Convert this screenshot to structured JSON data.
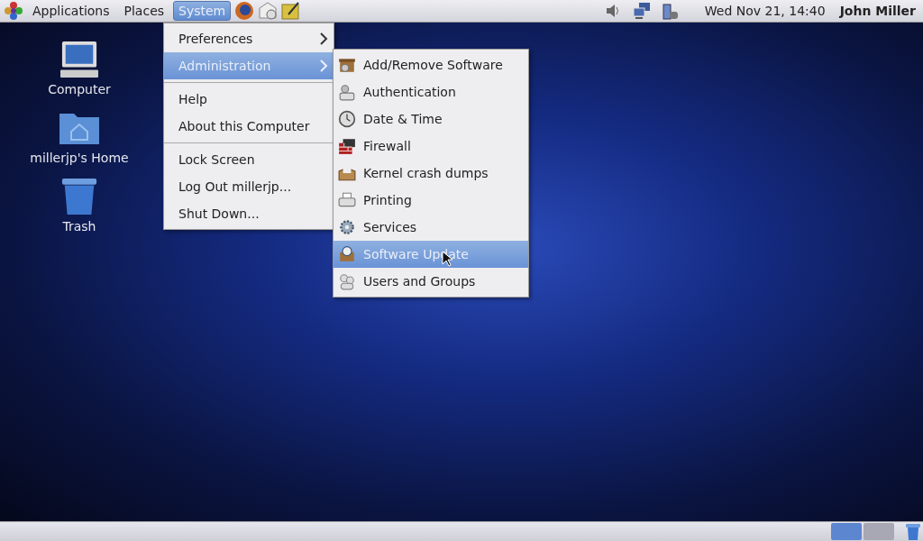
{
  "top_panel": {
    "menus": [
      {
        "label": "Applications",
        "selected": false
      },
      {
        "label": "Places",
        "selected": false
      },
      {
        "label": "System",
        "selected": true
      }
    ],
    "clock": "Wed Nov 21, 14:40",
    "user": "John Miller"
  },
  "desktop_icons": [
    {
      "label": "Computer",
      "kind": "computer"
    },
    {
      "label": "millerjp's Home",
      "kind": "home"
    },
    {
      "label": "Trash",
      "kind": "trash"
    }
  ],
  "system_menu": {
    "sections": [
      [
        {
          "label": "Preferences",
          "selected": false,
          "submenu": true
        },
        {
          "label": "Administration",
          "selected": true,
          "submenu": true
        }
      ],
      [
        {
          "label": "Help",
          "selected": false,
          "submenu": false
        },
        {
          "label": "About this Computer",
          "selected": false,
          "submenu": false
        }
      ],
      [
        {
          "label": "Lock Screen",
          "selected": false,
          "submenu": false
        },
        {
          "label": "Log Out millerjp...",
          "selected": false,
          "submenu": false
        },
        {
          "label": "Shut Down...",
          "selected": false,
          "submenu": false
        }
      ]
    ]
  },
  "administration_menu": {
    "items": [
      {
        "label": "Add/Remove Software",
        "kind": "package",
        "selected": false
      },
      {
        "label": "Authentication",
        "kind": "auth",
        "selected": false
      },
      {
        "label": "Date & Time",
        "kind": "clock",
        "selected": false
      },
      {
        "label": "Firewall",
        "kind": "firewall",
        "selected": false
      },
      {
        "label": "Kernel crash dumps",
        "kind": "box",
        "selected": false
      },
      {
        "label": "Printing",
        "kind": "printer",
        "selected": false
      },
      {
        "label": "Services",
        "kind": "gear",
        "selected": false
      },
      {
        "label": "Software Update",
        "kind": "update",
        "selected": true
      },
      {
        "label": "Users and Groups",
        "kind": "users",
        "selected": false
      }
    ]
  },
  "bottom_panel": {
    "workspaces": [
      {
        "selected": true
      },
      {
        "selected": false
      }
    ]
  }
}
